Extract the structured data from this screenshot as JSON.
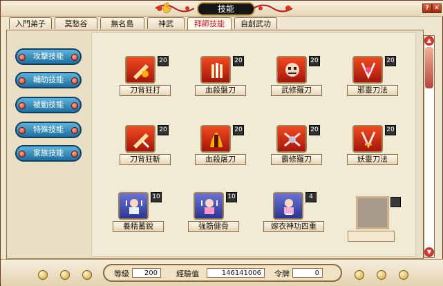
{
  "window": {
    "title": "技能"
  },
  "tabs": [
    {
      "label": "入門弟子"
    },
    {
      "label": "莫愁谷"
    },
    {
      "label": "無名島"
    },
    {
      "label": "神武"
    },
    {
      "label": "拜師技能",
      "active": true
    },
    {
      "label": "自創武功"
    }
  ],
  "sidebar": {
    "items": [
      {
        "label": "攻擊技能",
        "selected": true
      },
      {
        "label": "輔助技能"
      },
      {
        "label": "被動技能"
      },
      {
        "label": "特殊技能"
      },
      {
        "label": "家族技能"
      }
    ]
  },
  "skills": [
    {
      "name": "刀背狂打",
      "level": "20",
      "icon": "blade-strike-icon",
      "color": "red"
    },
    {
      "name": "血殺盤刀",
      "level": "20",
      "icon": "blood-blade-icon",
      "color": "red"
    },
    {
      "name": "武修羅刀",
      "level": "20",
      "icon": "demon-mask-icon",
      "color": "red"
    },
    {
      "name": "邪靈刀法",
      "level": "20",
      "icon": "evil-spirit-icon",
      "color": "red"
    },
    {
      "name": "刀背狂斬",
      "level": "20",
      "icon": "blade-slash-icon",
      "color": "red"
    },
    {
      "name": "血殺屠刀",
      "level": "20",
      "icon": "fire-blade-icon",
      "color": "red"
    },
    {
      "name": "霸修羅刀",
      "level": "20",
      "icon": "warrior-blade-icon",
      "color": "red"
    },
    {
      "name": "妖靈刀法",
      "level": "20",
      "icon": "yao-spirit-icon",
      "color": "red"
    },
    {
      "name": "養精蓄銳",
      "level": "10",
      "icon": "rest-buff-icon",
      "color": "blue"
    },
    {
      "name": "強筋健骨",
      "level": "10",
      "icon": "strength-buff-icon",
      "color": "blue"
    },
    {
      "name": "嫁衣神功四重",
      "level": "4",
      "icon": "divine-art-icon",
      "color": "blue"
    }
  ],
  "stats": {
    "level_label": "等級",
    "level_value": "200",
    "exp_label": "經驗值",
    "exp_value": "146141006",
    "token_label": "令牌",
    "token_value": "0"
  },
  "colors": {
    "frame": "#6b3a1c",
    "accent_red": "#c0102a",
    "sidebar_blue": "#1f6e9e"
  }
}
